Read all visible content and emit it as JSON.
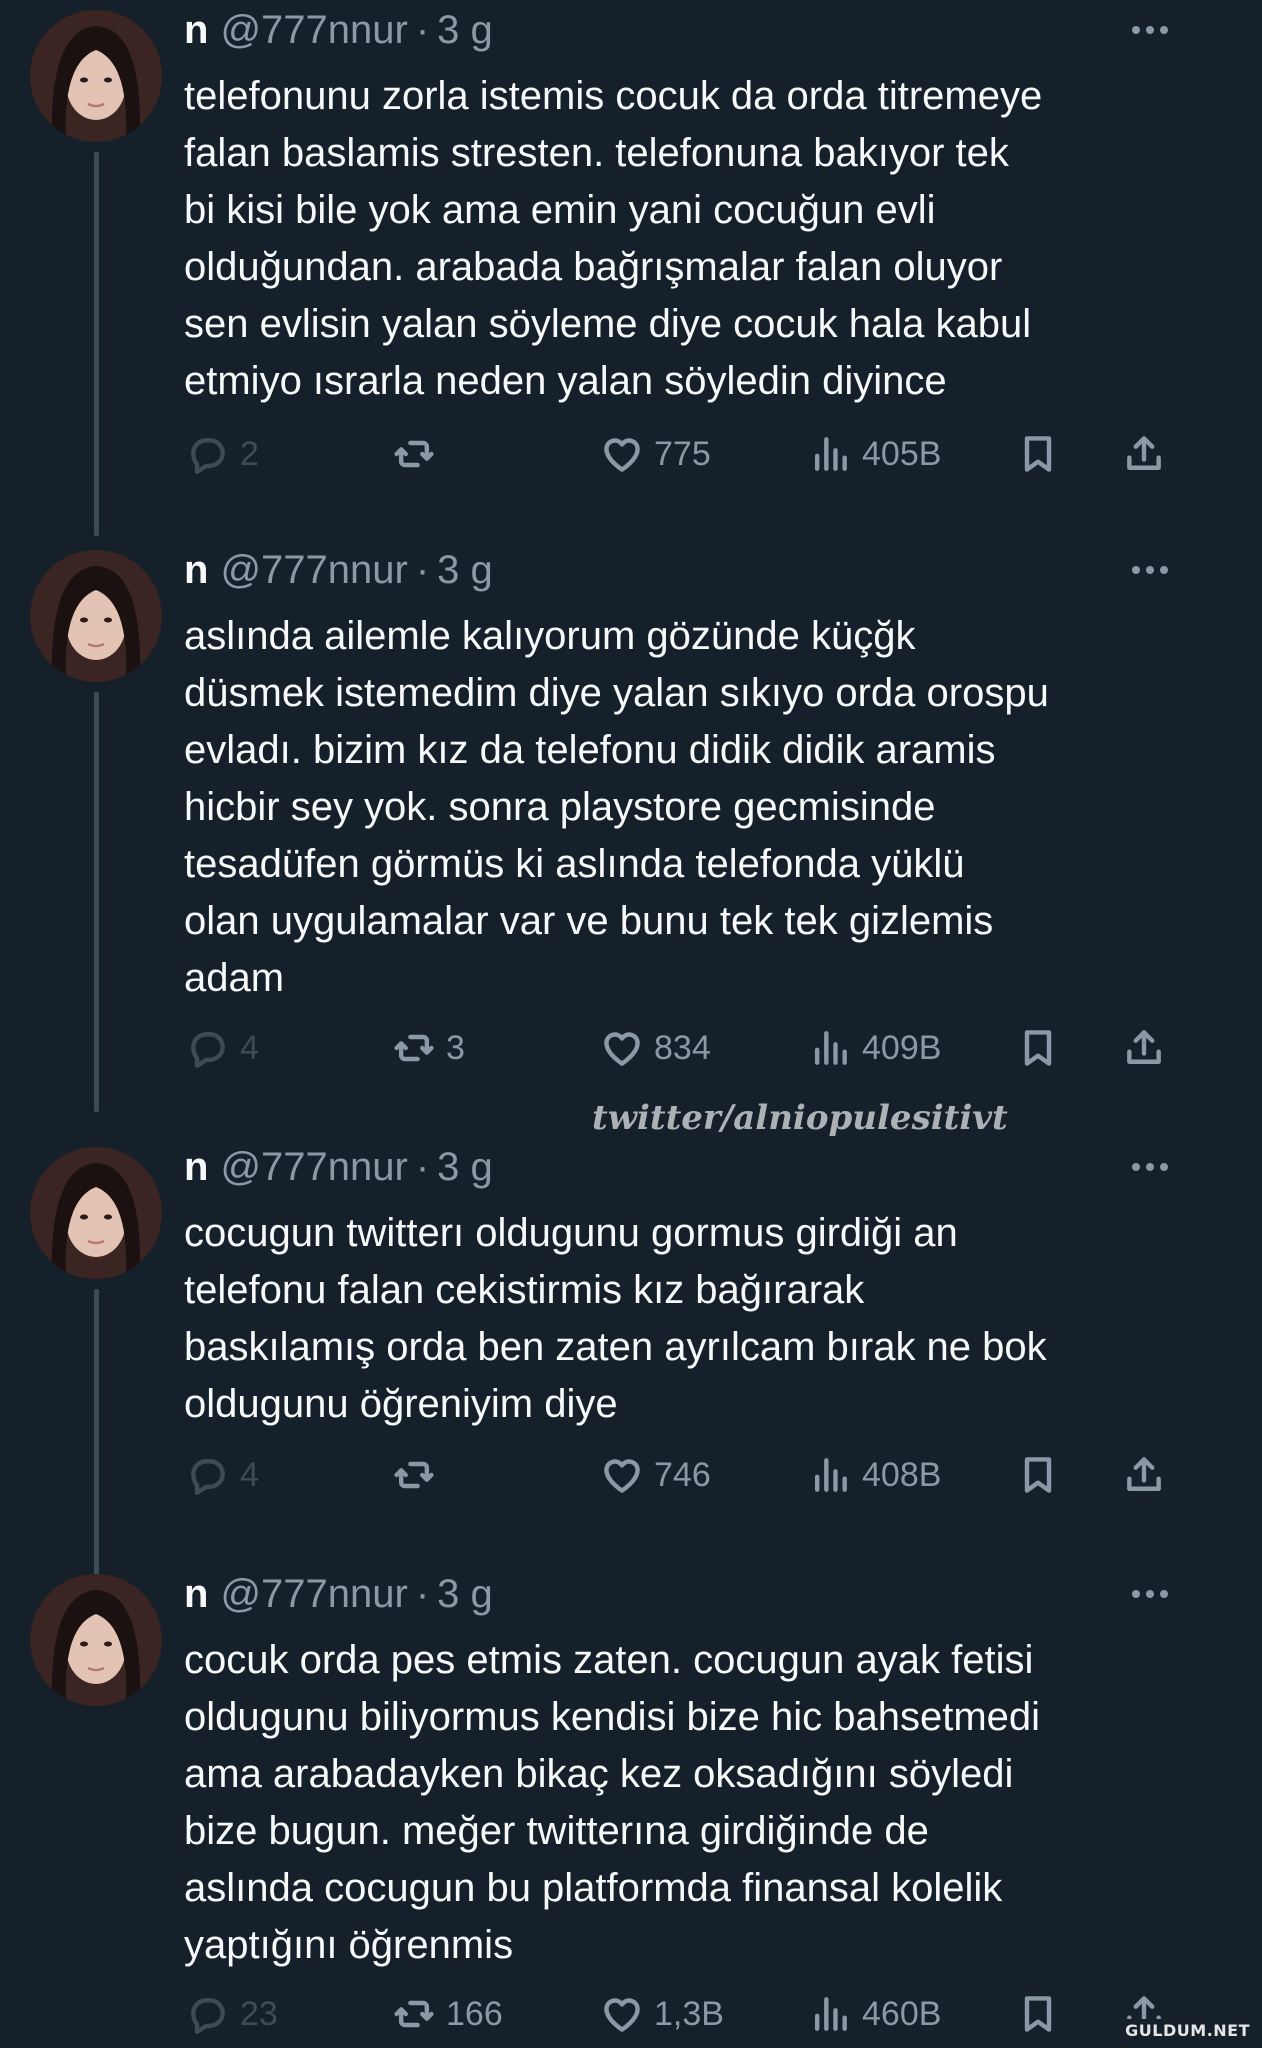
{
  "tweets": [
    {
      "name": "n",
      "handle": "@777nnur",
      "time": "3 g",
      "lines": [
        "telefonunu zorla istemis cocuk da orda titremeye",
        "falan baslamis stresten. telefonuna bakıyor tek",
        "bi kisi bile yok ama emin yani cocuğun evli",
        "olduğundan. arabada bağrışmalar falan oluyor",
        "sen evlisin yalan söyleme diye cocuk hala kabul",
        "etmiyo ısrarla neden yalan söyledin diyince"
      ],
      "replies": "2",
      "retweets": "",
      "likes": "775",
      "views": "405B"
    },
    {
      "name": "n",
      "handle": "@777nnur",
      "time": "3 g",
      "lines": [
        "aslında ailemle kalıyorum gözünde küçğk",
        "düsmek istemedim diye yalan sıkıyo orda orospu",
        "evladı. bizim kız da telefonu didik didik aramis",
        "hicbir sey yok. sonra playstore gecmisinde",
        "tesadüfen görmüs ki aslında telefonda yüklü",
        "olan uygulamalar var ve bunu tek tek gizlemis",
        "adam"
      ],
      "replies": "4",
      "retweets": "3",
      "likes": "834",
      "views": "409B"
    },
    {
      "name": "n",
      "handle": "@777nnur",
      "time": "3 g",
      "lines": [
        "cocugun twitterı oldugunu gormus girdiği an",
        "telefonu falan cekistirmis kız bağırarak",
        "baskılamış orda ben zaten ayrılcam bırak ne bok",
        "oldugunu öğreniyim diye"
      ],
      "replies": "4",
      "retweets": "",
      "likes": "746",
      "views": "408B"
    },
    {
      "name": "n",
      "handle": "@777nnur",
      "time": "3 g",
      "lines": [
        "cocuk orda pes etmis zaten. cocugun ayak fetisi",
        "oldugunu biliyormus kendisi bize hic bahsetmedi",
        "ama arabadayken bikaç kez oksadığını söyledi",
        "bize bugun. meğer twitterına girdiğinde de",
        "aslında cocugun bu platformda finansal kolelik",
        "yaptığını öğrenmis"
      ],
      "replies": "23",
      "retweets": "166",
      "likes": "1,3B",
      "views": "460B"
    }
  ],
  "watermark": "twitter/alniopulesitivt",
  "site_tag": "GULDUM.NET",
  "icons": {
    "reply": "reply-icon",
    "retweet": "retweet-icon",
    "like": "heart-icon",
    "views": "views-icon",
    "bookmark": "bookmark-icon",
    "share": "share-icon",
    "more": "more-icon"
  },
  "colors": {
    "background": "#15202b",
    "text": "#f7f9f9",
    "muted": "#8b98a5",
    "thread_line": "#3d4a57"
  }
}
